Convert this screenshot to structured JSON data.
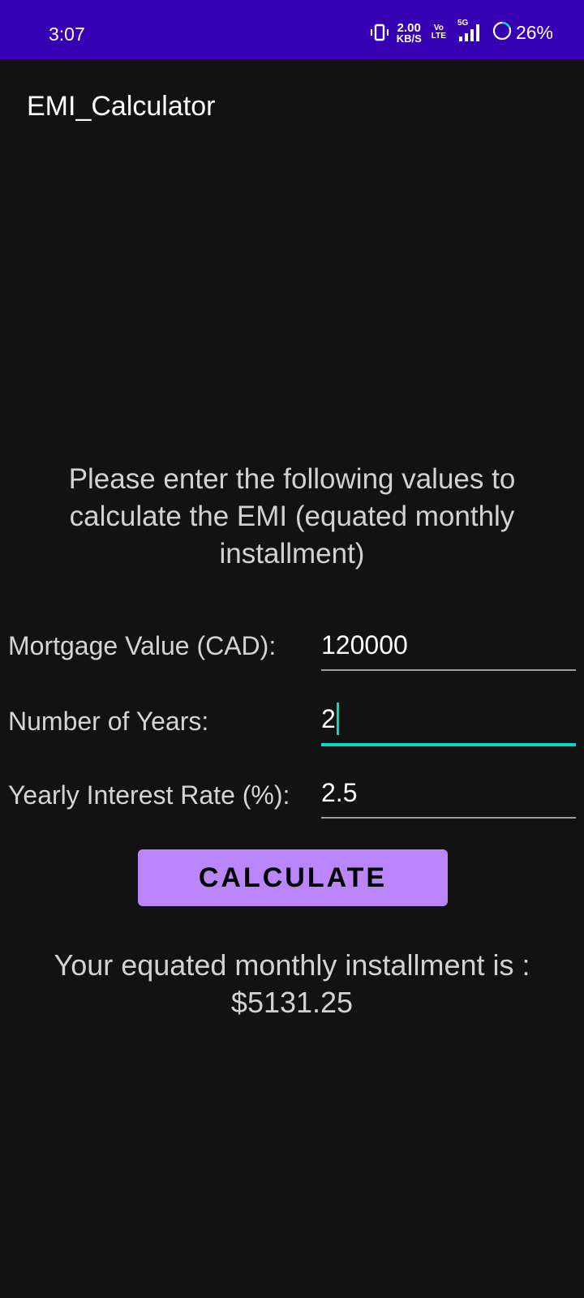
{
  "status_bar": {
    "time": "3:07",
    "net_speed_value": "2.00",
    "net_speed_unit": "KB/S",
    "volte_top": "Vo",
    "volte_bottom": "LTE",
    "network_type": "5G",
    "battery_percent": "26%",
    "background_color": "#3700b3"
  },
  "app": {
    "title": "EMI_Calculator",
    "accent_color": "#03dac5",
    "button_color": "#bb86fc"
  },
  "instruction": "Please enter the following values to calculate the EMI (equated monthly installment)",
  "form": {
    "mortgage_label": "Mortgage Value (CAD):",
    "mortgage_value": "120000",
    "years_label": "Number of Years:",
    "years_value": "2",
    "rate_label": "Yearly Interest Rate (%):",
    "rate_value": "2.5"
  },
  "calculate_button": "CALCULATE",
  "result": {
    "line1": "Your equated monthly installment is :",
    "line2": "$5131.25"
  },
  "icons": {
    "vibrate": "vibrate-icon",
    "signal": "signal-icon",
    "battery": "battery-icon"
  }
}
